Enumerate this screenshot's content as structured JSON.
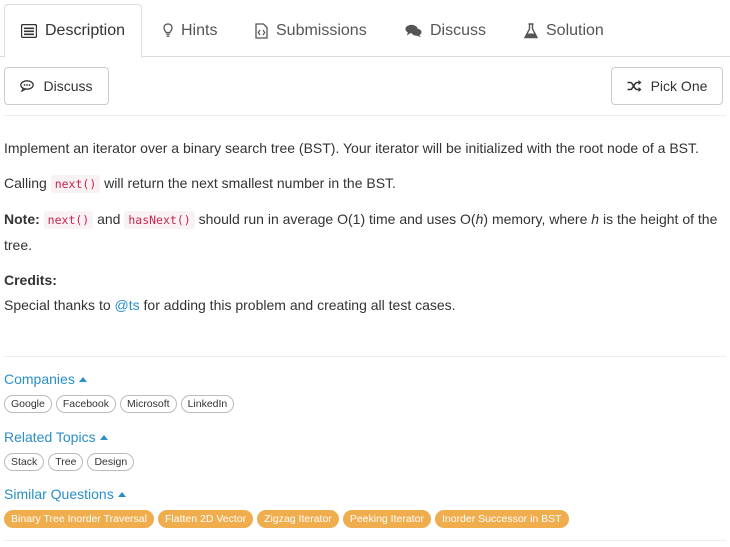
{
  "tabs": [
    {
      "label": "Description",
      "icon": "description-icon",
      "active": true
    },
    {
      "label": "Hints",
      "icon": "lightbulb-icon"
    },
    {
      "label": "Submissions",
      "icon": "file-code-icon"
    },
    {
      "label": "Discuss",
      "icon": "comments-icon"
    },
    {
      "label": "Solution",
      "icon": "flask-icon"
    }
  ],
  "toolbar": {
    "discuss_label": "Discuss",
    "pick_one_label": "Pick One"
  },
  "description": {
    "intro": "Implement an iterator over a binary search tree (BST). Your iterator will be initialized with the root node of a BST.",
    "calling_prefix": "Calling",
    "calling_code": "next()",
    "calling_suffix": "will return the next smallest number in the BST.",
    "note_label": "Note:",
    "note_code_1": "next()",
    "note_and": "and",
    "note_code_2": "hasNext()",
    "note_text_1": "should run in average O(1) time and uses O(",
    "note_h1": "h",
    "note_text_2": ") memory, where",
    "note_h2": "h",
    "note_text_3": "is the height of the tree.",
    "credits_title": "Credits:",
    "credits_prefix": "Special thanks to",
    "credits_user": "@ts",
    "credits_suffix": "for adding this problem and creating all test cases."
  },
  "companies": {
    "title": "Companies",
    "tags": [
      "Google",
      "Facebook",
      "Microsoft",
      "LinkedIn"
    ]
  },
  "related_topics": {
    "title": "Related Topics",
    "tags": [
      "Stack",
      "Tree",
      "Design"
    ]
  },
  "similar_questions": {
    "title": "Similar Questions",
    "tags": [
      "Binary Tree Inorder Traversal",
      "Flatten 2D Vector",
      "Zigzag Iterator",
      "Peeking Iterator",
      "Inorder Successor in BST"
    ],
    "tag_color": "#f0ad4e"
  },
  "colors": {
    "link": "#2a8ec8",
    "code_text": "#c7254e",
    "code_bg": "#f9f2f4"
  }
}
